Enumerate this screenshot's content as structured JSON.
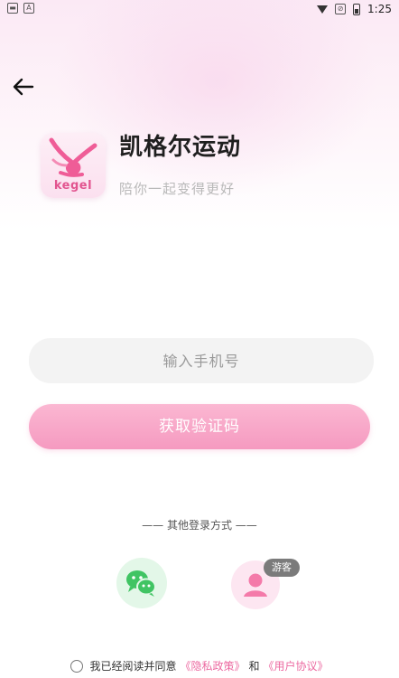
{
  "status_bar": {
    "time": "1:25"
  },
  "app": {
    "logo_text": "kegel",
    "title": "凯格尔运动",
    "subtitle": "陪你一起变得更好"
  },
  "login": {
    "phone_placeholder": "输入手机号",
    "get_code_label": "获取验证码"
  },
  "other_login": {
    "title": "—— 其他登录方式 ——",
    "guest_badge": "游客"
  },
  "agreement": {
    "prefix": "我已经阅读并同意",
    "privacy_policy": "《隐私政策》",
    "and": "和",
    "user_agreement": "《用户协议》"
  },
  "colors": {
    "accent_pink": "#f59ac0",
    "link_pink": "#ec6aa1",
    "wechat_green": "#40c463"
  }
}
